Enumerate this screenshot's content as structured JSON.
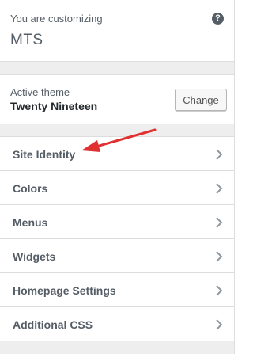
{
  "header": {
    "customizing_label": "You are customizing",
    "site_title": "MTS",
    "help_icon_glyph": "?"
  },
  "theme": {
    "label": "Active theme",
    "name": "Twenty Nineteen",
    "change_label": "Change"
  },
  "menu": {
    "items": [
      {
        "label": "Site Identity"
      },
      {
        "label": "Colors"
      },
      {
        "label": "Menus"
      },
      {
        "label": "Widgets"
      },
      {
        "label": "Homepage Settings"
      },
      {
        "label": "Additional CSS"
      }
    ]
  },
  "colors": {
    "annotation_arrow": "#e03030",
    "panel_background": "#eeeeee",
    "text": "#555d66"
  },
  "icons": {
    "help": "help-icon",
    "chevron": "chevron-right-icon",
    "annotation": "red-arrow-icon"
  }
}
